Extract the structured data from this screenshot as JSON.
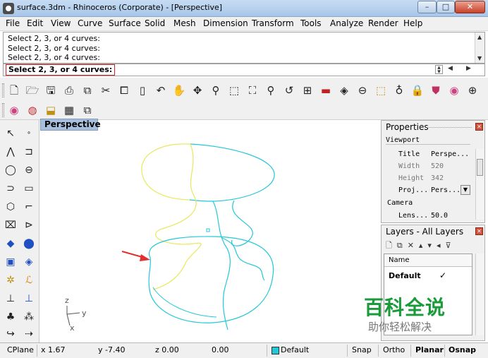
{
  "window": {
    "title": "surface.3dm - Rhinoceros (Corporate) - [Perspective]",
    "min": "–",
    "max": "□",
    "close": "✕"
  },
  "menu": [
    "File",
    "Edit",
    "View",
    "Curve",
    "Surface",
    "Solid",
    "Mesh",
    "Dimension",
    "Transform",
    "Tools",
    "Analyze",
    "Render",
    "Help"
  ],
  "command_history": [
    "Select 2, 3, or 4 curves:",
    "Select 2, 3, or 4 curves:",
    "Select 2, 3, or 4 curves:"
  ],
  "command_prompt": "Select 2, 3, or 4 curves:",
  "viewport": {
    "tab_label": "Perspective",
    "axis_labels": {
      "z": "z",
      "y": "y",
      "x": "x"
    },
    "colors": {
      "curve_yellow": "#e8e85a",
      "curve_cyan": "#22c8d8",
      "arrow": "#e03030"
    }
  },
  "properties": {
    "title": "Properties",
    "section": "Viewport",
    "rows": [
      {
        "label": "Title",
        "value": "Perspe..."
      },
      {
        "label": "Width",
        "value": "520"
      },
      {
        "label": "Height",
        "value": "342"
      },
      {
        "label": "Proj...",
        "value": "Pers..."
      }
    ],
    "camera_section": "Camera",
    "camera_rows": [
      {
        "label": "Lens...",
        "value": "50.0"
      }
    ]
  },
  "layers": {
    "title": "Layers - All Layers",
    "column_name": "Name",
    "rows": [
      {
        "name": "Default",
        "current": "✓"
      }
    ]
  },
  "watermark": {
    "line1": "百科全说",
    "line2": "助你轻松解决"
  },
  "status": {
    "cplane": "CPlane",
    "x": "x 1.67",
    "y": "y -7.40",
    "z": "z 0.00",
    "d": "0.00",
    "layer": "Default",
    "layer_color": "#22c8d8",
    "snap": "Snap",
    "ortho": "Ortho",
    "planar": "Planar",
    "osnap": "Osnap"
  }
}
